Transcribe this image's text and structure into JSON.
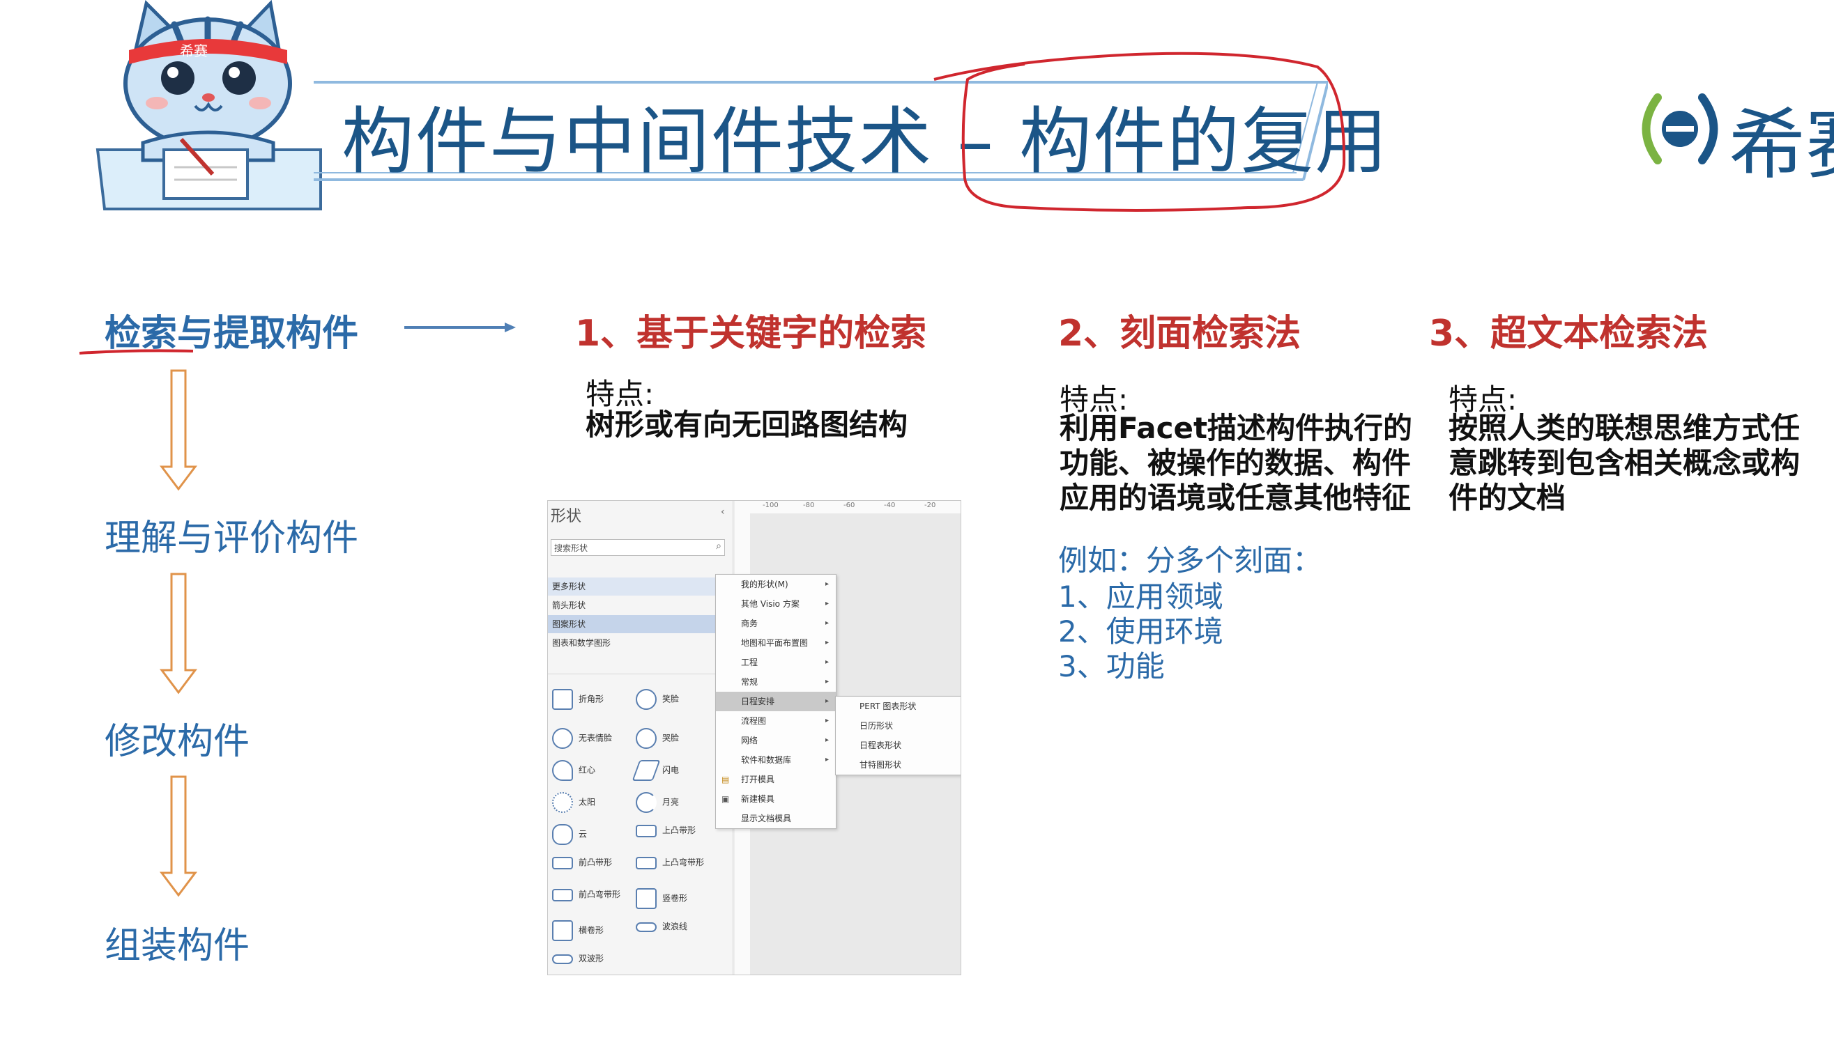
{
  "header": {
    "title_left": "构件与中间件技术",
    "title_dash": "–",
    "title_right": "构件的复用",
    "mascot_headband": "希赛",
    "logo_text": "希赛"
  },
  "flow": {
    "steps": [
      "检索与提取构件",
      "理解与评价构件",
      "修改构件",
      "组装构件"
    ]
  },
  "columns": [
    {
      "title": "1、基于关键字的检索",
      "feature_label": "特点:",
      "feature_lines": [
        "树形或有向无回路图结构"
      ]
    },
    {
      "title": "2、刻面检索法",
      "feature_label": "特点:",
      "feature_lines": [
        "利用Facet描述构件执行的",
        "功能、被操作的数据、构件",
        "应用的语境或任意其他特征"
      ],
      "example_label": "例如：分多个刻面：",
      "examples": [
        "1、应用领域",
        "2、使用环境",
        "3、功能"
      ]
    },
    {
      "title": "3、超文本检索法",
      "feature_label": "特点:",
      "feature_lines": [
        "按照人类的联想思维方式任",
        "意跳转到包含相关概念或构",
        "件的文档"
      ]
    }
  ],
  "screenshot": {
    "panel_title": "形状",
    "search_placeholder": "搜索形状",
    "categories": [
      "更多形状",
      "箭头形状",
      "图案形状",
      "图表和数学图形"
    ],
    "selected_category": "图案形状",
    "ruler_marks": [
      "-100",
      "-80",
      "-60",
      "-40",
      "-20"
    ],
    "shapes_left": [
      "折角形",
      "无表情脸",
      "红心",
      "太阳",
      "云",
      "前凸带形",
      "前凸弯带形",
      "横卷形",
      "双波形"
    ],
    "shapes_right": [
      "笑脸",
      "哭脸",
      "闪电",
      "月亮",
      "上凸带形",
      "上凸弯带形",
      "竖卷形",
      "波浪线"
    ],
    "menu1": [
      "我的形状(M)",
      "其他 Visio 方案",
      "商务",
      "地图和平面布置图",
      "工程",
      "常规",
      "日程安排",
      "流程图",
      "网络",
      "软件和数据库",
      "打开模具",
      "新建模具",
      "显示文档模具"
    ],
    "menu1_selected": "日程安排",
    "menu2": [
      "PERT 图表形状",
      "日历形状",
      "日程表形状",
      "甘特图形状"
    ]
  },
  "colors": {
    "title_blue": "#1b5587",
    "step_blue": "#2b6aa8",
    "heading_red": "#c0322e",
    "arrow_orange": "#e0934a",
    "annotation_red": "#d0262e"
  }
}
